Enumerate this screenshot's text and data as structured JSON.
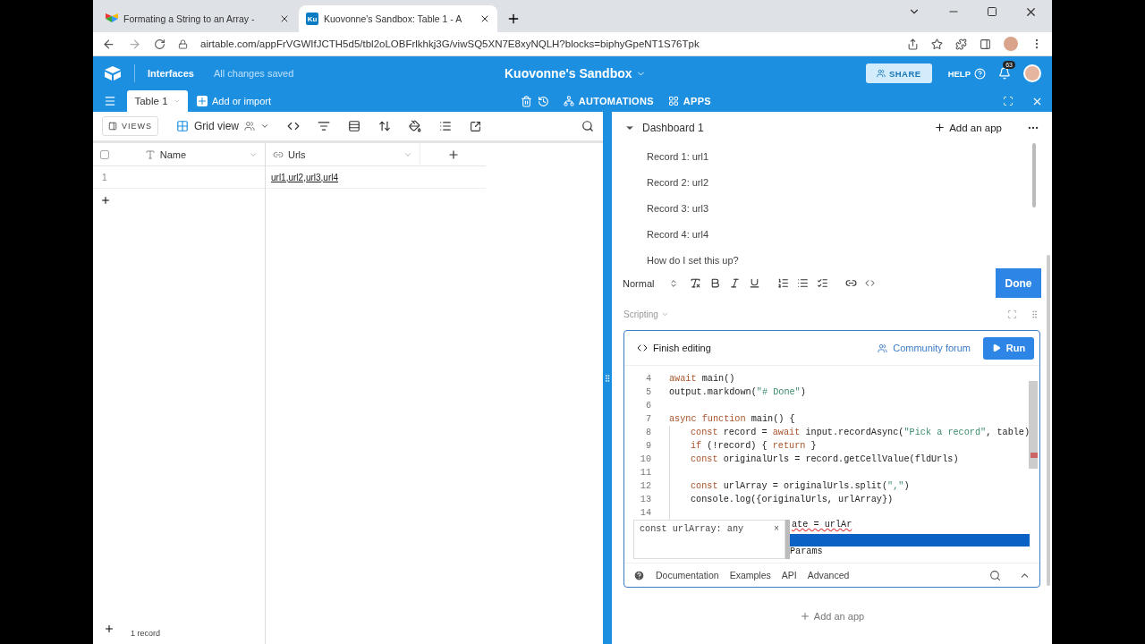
{
  "browser": {
    "tabs": [
      {
        "title": "Formating a String to an Array - ",
        "kind": "colorful",
        "selected": false
      },
      {
        "title": "Kuovonne's Sandbox: Table 1 - A",
        "kind": "lettered",
        "icon_text": "Ku",
        "selected": true
      }
    ],
    "url": "airtable.com/appFrVGWIfJCTH5d5/tbl2oLOBFrlkhkj3G/viwSQ5XN7E8xyNQLH?blocks=biphyGpeNT1S76Tpk"
  },
  "app_header": {
    "interfaces_label": "Interfaces",
    "save_status": "All changes saved",
    "base_name": "Kuovonne's Sandbox",
    "share_button": "SHARE",
    "help": "HELP",
    "notification_count": "63"
  },
  "table_bar": {
    "tabs": [
      {
        "label": "Table 1",
        "selected": true
      }
    ],
    "add_or_import": "Add or import",
    "automations": "AUTOMATIONS",
    "apps": "APPS"
  },
  "view_bar": {
    "views_button": "VIEWS",
    "view_name": "Grid view"
  },
  "grid": {
    "select_all_checked": false,
    "columns": [
      {
        "name": "Name",
        "kind": "text"
      },
      {
        "name": "Urls",
        "kind": "link"
      }
    ],
    "rows": [
      {
        "number": "1",
        "urls": "url1,url2,url3,url4"
      }
    ],
    "footer": "1 record"
  },
  "dashboard": {
    "title": "Dashboard 1",
    "add_app": "Add an app",
    "text_lines": [
      "Record 1: url1",
      "Record 2: url2",
      "Record 3: url3",
      "Record 4: url4",
      "How do I set this up?"
    ],
    "text_style": "Normal",
    "done_button": "Done",
    "script_app": {
      "title": "Scripting",
      "finish_editing": "Finish editing",
      "community_forum": "Community forum",
      "run_button": "Run",
      "code_lines": [
        {
          "number": "4",
          "indented": false,
          "tokens": [
            {
              "kind": "keyword",
              "text": "await"
            },
            {
              "kind": "plain",
              "text": " main()"
            }
          ]
        },
        {
          "number": "5",
          "indented": false,
          "tokens": [
            {
              "kind": "plain",
              "text": "output.markdown("
            },
            {
              "kind": "string",
              "text": "\"# Done\""
            },
            {
              "kind": "plain",
              "text": ")"
            }
          ]
        },
        {
          "number": "6",
          "indented": false
        },
        {
          "number": "7",
          "indented": false,
          "tokens": [
            {
              "kind": "keyword",
              "text": "async"
            },
            {
              "kind": "keyword",
              "text": " function"
            },
            {
              "kind": "plain",
              "text": " main() {"
            }
          ]
        },
        {
          "number": "8",
          "indented": true,
          "tokens": [
            {
              "kind": "keyword",
              "text": "const"
            },
            {
              "kind": "plain",
              "text": " record = "
            },
            {
              "kind": "keyword",
              "text": "await"
            },
            {
              "kind": "plain",
              "text": " input.recordAsync("
            },
            {
              "kind": "string",
              "text": "\"Pick a record\""
            },
            {
              "kind": "plain",
              "text": ", table)"
            }
          ]
        },
        {
          "number": "9",
          "indented": true,
          "tokens": [
            {
              "kind": "keyword",
              "text": "if"
            },
            {
              "kind": "plain",
              "text": " (!record) { "
            },
            {
              "kind": "keyword",
              "text": "return"
            },
            {
              "kind": "plain",
              "text": " }"
            }
          ]
        },
        {
          "number": "10",
          "indented": true,
          "tokens": [
            {
              "kind": "keyword",
              "text": "const"
            },
            {
              "kind": "plain",
              "text": " originalUrls = record.getCellValue(fldUrls)"
            }
          ]
        },
        {
          "number": "11",
          "indented": true
        },
        {
          "number": "12",
          "indented": true,
          "tokens": [
            {
              "kind": "keyword",
              "text": "const"
            },
            {
              "kind": "plain",
              "text": " urlArray = originalUrls.split("
            },
            {
              "kind": "string",
              "text": "\",\""
            },
            {
              "kind": "plain",
              "text": ")"
            }
          ]
        },
        {
          "number": "13",
          "indented": true,
          "tokens": [
            {
              "kind": "plain",
              "text": "console.log({originalUrls, urlArray})"
            }
          ]
        },
        {
          "number": "14",
          "indented": true
        }
      ],
      "autocomplete": {
        "hint": "const urlArray: any",
        "close": "×",
        "line_rest": "ate = urlAr",
        "suggestions": [
          {
            "selected": true
          },
          {
            "label": "Params",
            "selected": false
          }
        ]
      },
      "footer_links": [
        "Documentation",
        "Examples",
        "API",
        "Advanced"
      ]
    },
    "add_app_bottom": "Add an app"
  }
}
